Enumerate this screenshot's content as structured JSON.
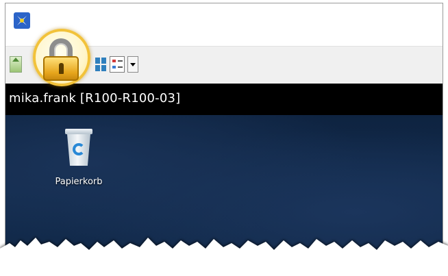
{
  "toolbar": {
    "buttons": [
      {
        "name": "home",
        "icon": "home-icon"
      },
      {
        "name": "lock",
        "icon": "lock-icon",
        "highlighted": true
      },
      {
        "name": "grid-view",
        "icon": "tile-view-icon"
      },
      {
        "name": "list-view",
        "icon": "list-view-icon"
      },
      {
        "name": "dropdown",
        "icon": "chevron-down-icon"
      }
    ],
    "highlight_color": "#f2c23a"
  },
  "session": {
    "title": "mika.frank [R100-R100-03]"
  },
  "desktop": {
    "icons": [
      {
        "label": "Papierkorb",
        "icon": "recycle-bin-icon"
      }
    ],
    "background_color": "#132c4e"
  }
}
